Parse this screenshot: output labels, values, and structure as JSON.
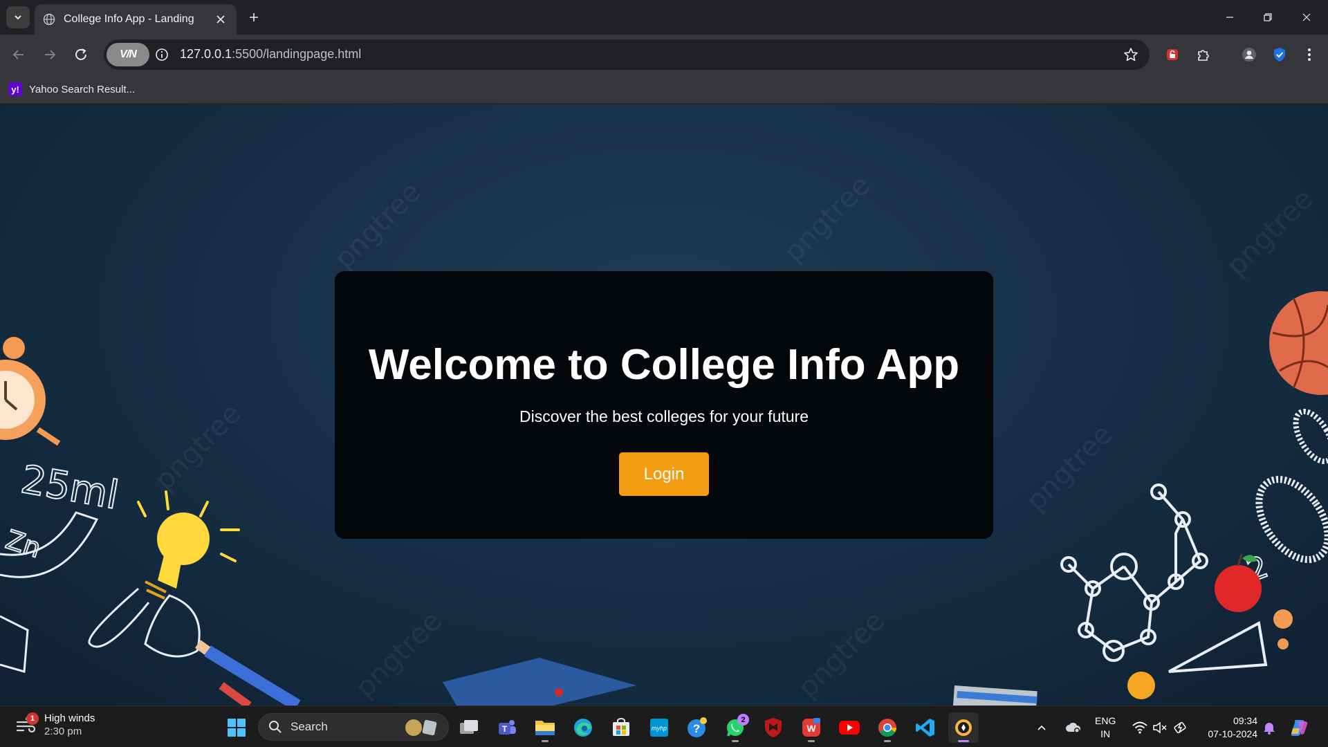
{
  "browser": {
    "tab_title": "College Info App - Landing",
    "url_host": "127.0.0.1",
    "url_rest": ":5500/landingpage.html",
    "vpn_label": "V/N"
  },
  "bookmarks": [
    {
      "label": "Yahoo Search Result...",
      "icon_text": "y!"
    }
  ],
  "page": {
    "heading": "Welcome to College Info App",
    "subtitle": "Discover the best colleges for your future",
    "login_label": "Login",
    "accent_color": "#f39c12",
    "background_decor_text": {
      "chalk_volume": "25ml",
      "chalk_element": "Zn"
    }
  },
  "taskbar": {
    "weather": {
      "badge": "1",
      "title": "High winds",
      "time": "2:30 pm"
    },
    "search_label": "Search",
    "whatsapp_badge": "2",
    "language": {
      "line1": "ENG",
      "line2": "IN"
    },
    "clock": {
      "time": "09:34",
      "date": "07-10-2024"
    }
  }
}
